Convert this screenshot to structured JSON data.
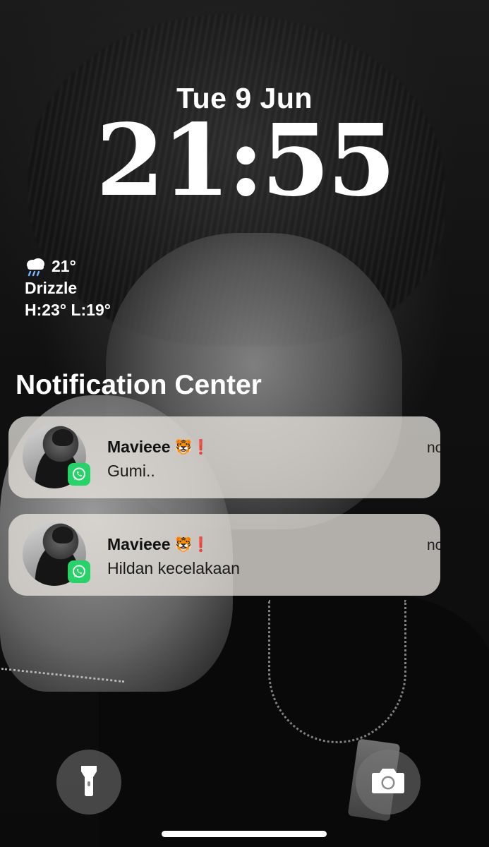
{
  "lock_screen": {
    "date": "Tue 9 Jun",
    "time": "21:55"
  },
  "weather": {
    "icon": "cloud-rain-icon",
    "temperature": "21°",
    "condition": "Drizzle",
    "high_low": "H:23° L:19°"
  },
  "notification_center": {
    "title": "Notification Center",
    "notifications": [
      {
        "app_icon": "whatsapp-icon",
        "sender": "Mavieee",
        "sender_emojis": "🐯❗",
        "message": "Gumi..",
        "time": "now"
      },
      {
        "app_icon": "whatsapp-icon",
        "sender": "Mavieee",
        "sender_emojis": "🐯❗",
        "message": "Hildan kecelakaan",
        "time": "now"
      }
    ]
  },
  "controls": {
    "left_icon": "flashlight-icon",
    "right_icon": "camera-icon"
  },
  "colors": {
    "whatsapp_green": "#25d366",
    "notification_bg": "#ece8e2",
    "text_primary": "#ffffff"
  }
}
